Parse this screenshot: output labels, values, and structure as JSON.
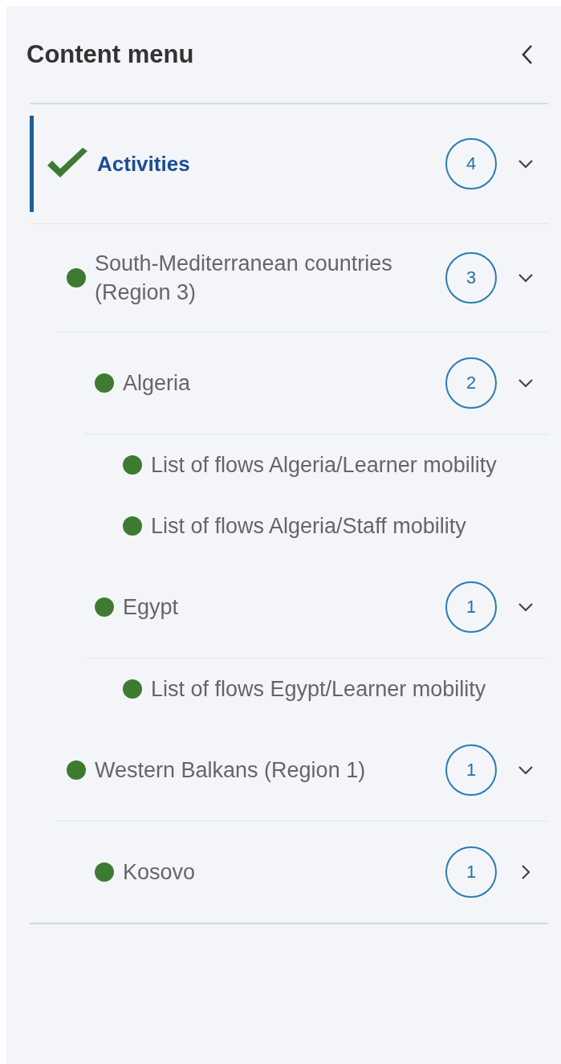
{
  "header": {
    "title": "Content menu"
  },
  "tree": [
    {
      "label": "Activities",
      "kind": "check",
      "selected": true,
      "count": "4",
      "expanded": true,
      "children": [
        {
          "label": "South-Mediterranean countries (Region 3)",
          "kind": "dot",
          "selected": false,
          "count": "3",
          "expanded": true,
          "children": [
            {
              "label": "Algeria",
              "kind": "dot",
              "selected": false,
              "count": "2",
              "expanded": true,
              "children": [
                {
                  "label": "List of flows Algeria/Learner mobility",
                  "kind": "dot",
                  "selected": false
                },
                {
                  "label": "List of flows Algeria/Staff mobility",
                  "kind": "dot",
                  "selected": false
                }
              ]
            },
            {
              "label": "Egypt",
              "kind": "dot",
              "selected": false,
              "count": "1",
              "expanded": true,
              "children": [
                {
                  "label": "List of flows Egypt/Learner mobility",
                  "kind": "dot",
                  "selected": false
                }
              ]
            }
          ]
        },
        {
          "label": "Western Balkans (Region 1)",
          "kind": "dot",
          "selected": false,
          "count": "1",
          "expanded": true,
          "children": [
            {
              "label": "Kosovo",
              "kind": "dot",
              "selected": false,
              "count": "1",
              "expanded": false
            }
          ]
        }
      ]
    }
  ]
}
